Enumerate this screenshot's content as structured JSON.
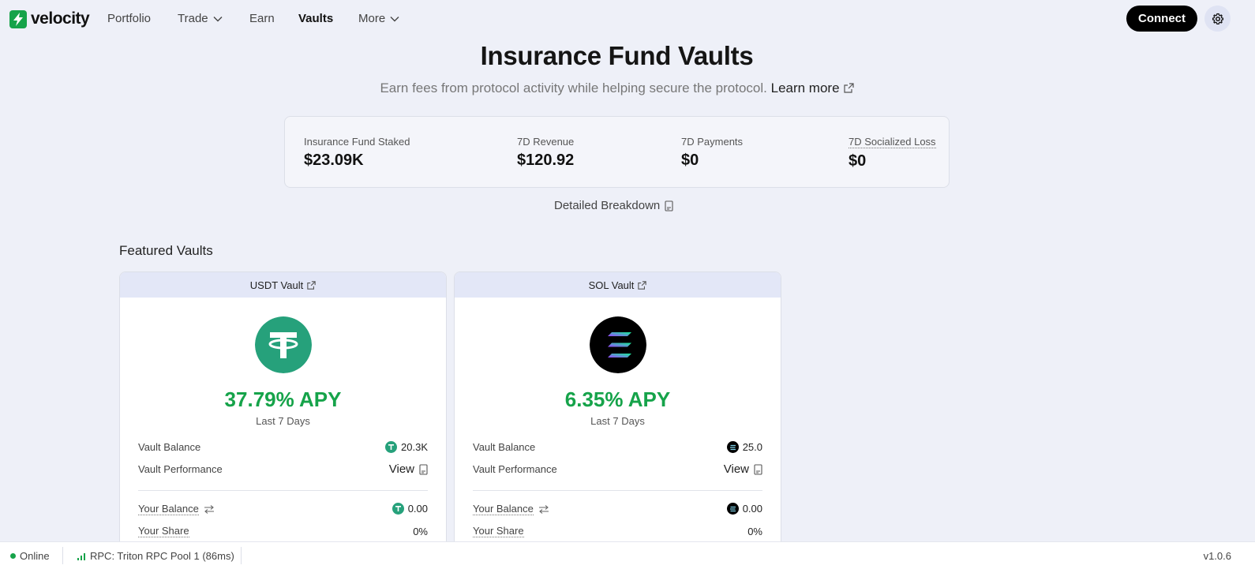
{
  "brand": {
    "name": "velocity",
    "icon": "bolt-logo-icon",
    "color": "#16a34a"
  },
  "nav": {
    "portfolio": "Portfolio",
    "trade": "Trade",
    "earn": "Earn",
    "vaults": "Vaults",
    "more": "More"
  },
  "header": {
    "connect_label": "Connect",
    "settings_icon": "gear-icon"
  },
  "hero": {
    "title": "Insurance Fund Vaults",
    "subtitle": "Earn fees from protocol activity while helping secure the protocol.",
    "learn_more": "Learn more"
  },
  "stats": [
    {
      "label": "Insurance Fund Staked",
      "value": "$23.09K"
    },
    {
      "label": "7D Revenue",
      "value": "$120.92"
    },
    {
      "label": "7D Payments",
      "value": "$0"
    },
    {
      "label": "7D Socialized Loss",
      "value": "$0"
    }
  ],
  "breakdown_label": "Detailed Breakdown",
  "featured_title": "Featured Vaults",
  "vaults": [
    {
      "title": "USDT Vault",
      "apy": "37.79% APY",
      "apy_period": "Last 7 Days",
      "balance_label": "Vault Balance",
      "balance_value": "20.3K",
      "performance_label": "Vault Performance",
      "performance_link": "View",
      "your_balance_label": "Your Balance",
      "your_balance_value": "0.00",
      "your_share_label": "Your Share",
      "your_share_value": "0%",
      "token_icon": "usdt-icon",
      "token_color": "#26a17b"
    },
    {
      "title": "SOL Vault",
      "apy": "6.35% APY",
      "apy_period": "Last 7 Days",
      "balance_label": "Vault Balance",
      "balance_value": "25.0",
      "performance_label": "Vault Performance",
      "performance_link": "View",
      "your_balance_label": "Your Balance",
      "your_balance_value": "0.00",
      "your_share_label": "Your Share",
      "your_share_value": "0%",
      "token_icon": "sol-icon",
      "token_color": "#000000"
    }
  ],
  "status": {
    "online": "Online",
    "rpc": "RPC: Triton RPC Pool 1 (86ms)",
    "version": "v1.0.6"
  },
  "colors": {
    "accent_green": "#16a34a",
    "background": "#eef0f8",
    "card_header": "#e3e7f7"
  }
}
